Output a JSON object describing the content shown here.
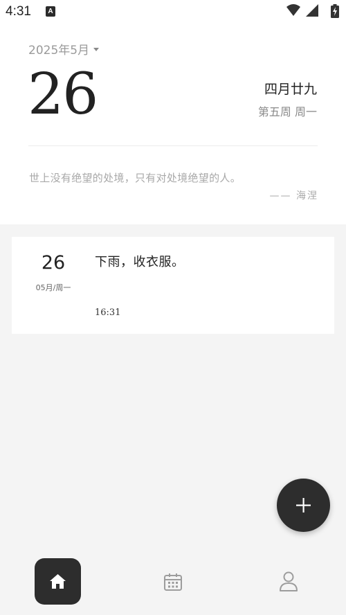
{
  "status_bar": {
    "time": "4:31",
    "app_icon_letter": "A"
  },
  "header": {
    "month_selector": "2025年5月",
    "day": "26",
    "lunar_date": "四月廿九",
    "week_info": "第五周 周一",
    "quote": {
      "text": "世上没有绝望的处境，只有对处境绝望的人。",
      "author": "—— 海涅"
    }
  },
  "notes": [
    {
      "day": "26",
      "sub": "05月/周一",
      "text": "下雨，收衣服。",
      "time": "16:31"
    }
  ],
  "fab": {
    "icon": "plus-icon"
  },
  "bottom_nav": {
    "items": [
      {
        "icon": "home-icon",
        "active": true
      },
      {
        "icon": "calendar-icon",
        "active": false
      },
      {
        "icon": "person-icon",
        "active": false
      }
    ]
  },
  "colors": {
    "background": "#f4f4f4",
    "card": "#ffffff",
    "accent_dark": "#2d2d2d",
    "muted_text": "#a8a8a8"
  }
}
